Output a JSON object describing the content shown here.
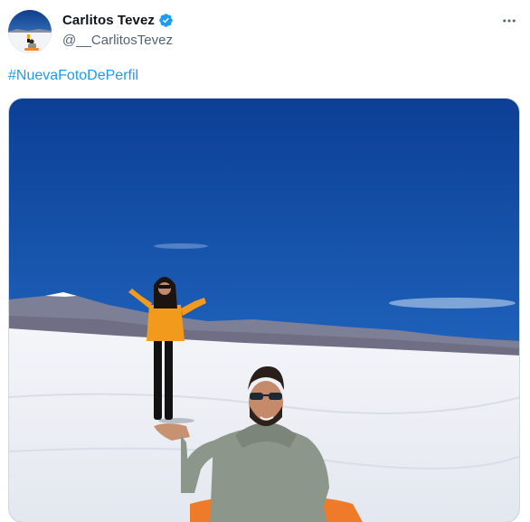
{
  "user": {
    "display_name": "Carlitos Tevez",
    "handle": "@__CarlitosTevez",
    "avatar_icon": "profile-photo",
    "verified_icon": "verified-badge-icon"
  },
  "tweet": {
    "text": "#NuevaFotoDePerfil",
    "more_icon": "more-options-icon"
  },
  "media": {
    "icon": "photo",
    "sky_color": "#1d5fb8",
    "salt_color": "#eef1f6"
  },
  "colors": {
    "link": "#1d9bf0",
    "verified": "#1d9bf0",
    "text_primary": "#0f1419",
    "text_secondary": "#536471"
  }
}
